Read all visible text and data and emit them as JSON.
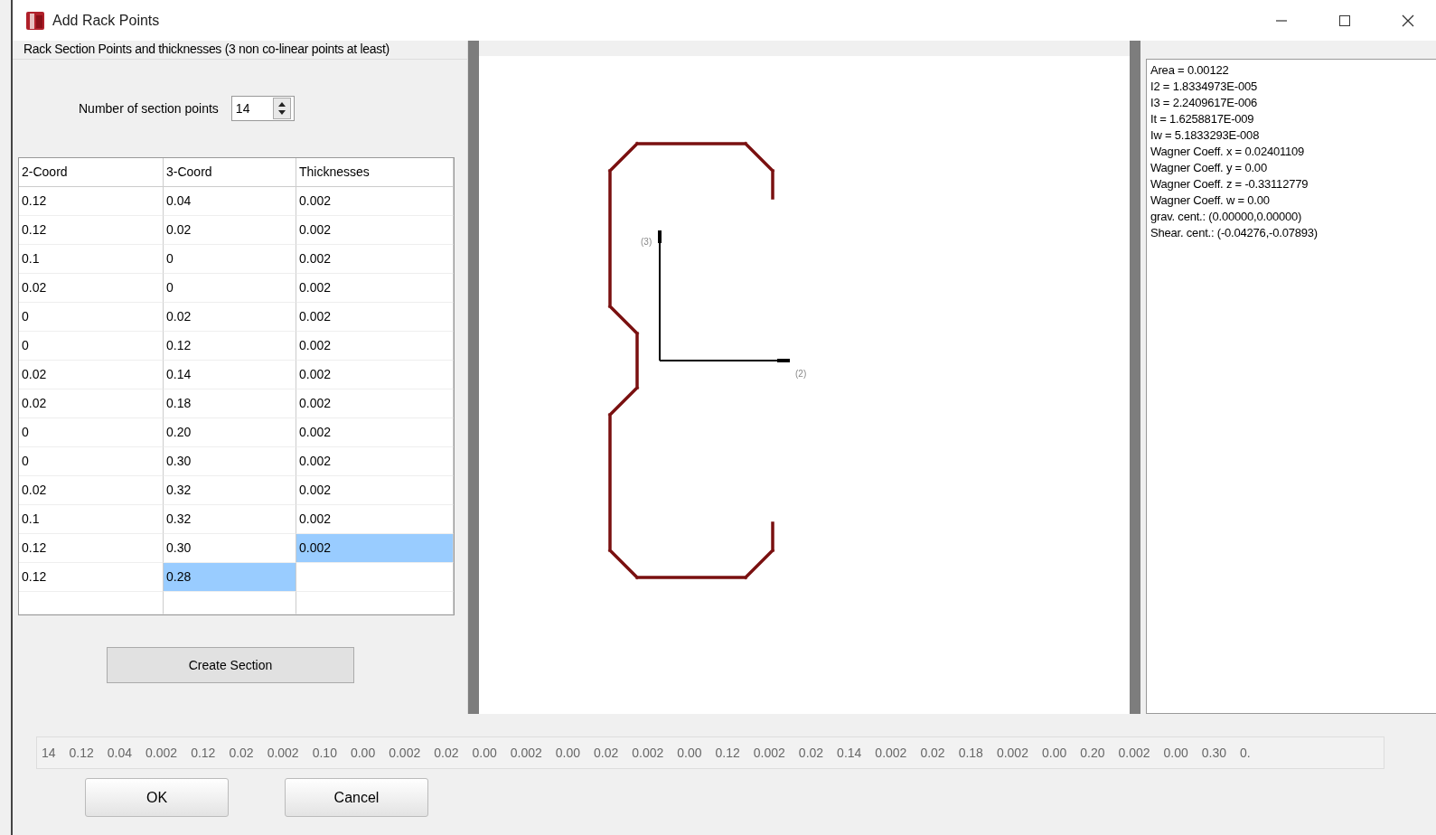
{
  "window": {
    "title": "Add Rack Points"
  },
  "group_title": "Rack Section Points and thicknesses (3 non co-linear points at least)",
  "section_points": {
    "label": "Number of section points",
    "value": "14"
  },
  "table": {
    "columns": [
      "2-Coord",
      "3-Coord",
      "Thicknesses"
    ],
    "rows": [
      {
        "cells": [
          {
            "text": "0.12",
            "selected": false
          },
          {
            "text": "0.04",
            "selected": false
          },
          {
            "text": "0.002",
            "selected": false
          }
        ]
      },
      {
        "cells": [
          {
            "text": "0.12",
            "selected": false
          },
          {
            "text": "0.02",
            "selected": false
          },
          {
            "text": "0.002",
            "selected": false
          }
        ]
      },
      {
        "cells": [
          {
            "text": "0.1",
            "selected": false
          },
          {
            "text": "0",
            "selected": false
          },
          {
            "text": "0.002",
            "selected": false
          }
        ]
      },
      {
        "cells": [
          {
            "text": "0.02",
            "selected": false
          },
          {
            "text": "0",
            "selected": false
          },
          {
            "text": "0.002",
            "selected": false
          }
        ]
      },
      {
        "cells": [
          {
            "text": "0",
            "selected": false
          },
          {
            "text": "0.02",
            "selected": false
          },
          {
            "text": "0.002",
            "selected": false
          }
        ]
      },
      {
        "cells": [
          {
            "text": "0",
            "selected": false
          },
          {
            "text": "0.12",
            "selected": false
          },
          {
            "text": "0.002",
            "selected": false
          }
        ]
      },
      {
        "cells": [
          {
            "text": "0.02",
            "selected": false
          },
          {
            "text": "0.14",
            "selected": false
          },
          {
            "text": "0.002",
            "selected": false
          }
        ]
      },
      {
        "cells": [
          {
            "text": "0.02",
            "selected": false
          },
          {
            "text": "0.18",
            "selected": false
          },
          {
            "text": "0.002",
            "selected": false
          }
        ]
      },
      {
        "cells": [
          {
            "text": "0",
            "selected": false
          },
          {
            "text": "0.20",
            "selected": false
          },
          {
            "text": "0.002",
            "selected": false
          }
        ]
      },
      {
        "cells": [
          {
            "text": "0",
            "selected": false
          },
          {
            "text": "0.30",
            "selected": false
          },
          {
            "text": "0.002",
            "selected": false
          }
        ]
      },
      {
        "cells": [
          {
            "text": "0.02",
            "selected": false
          },
          {
            "text": "0.32",
            "selected": false
          },
          {
            "text": "0.002",
            "selected": false
          }
        ]
      },
      {
        "cells": [
          {
            "text": "0.1",
            "selected": false
          },
          {
            "text": "0.32",
            "selected": false
          },
          {
            "text": "0.002",
            "selected": false
          }
        ]
      },
      {
        "cells": [
          {
            "text": "0.12",
            "selected": false
          },
          {
            "text": "0.30",
            "selected": false
          },
          {
            "text": "0.002",
            "selected": true
          }
        ]
      },
      {
        "cells": [
          {
            "text": "0.12",
            "selected": false
          },
          {
            "text": "0.28",
            "selected": true
          }
        ]
      }
    ]
  },
  "create_button": "Create Section",
  "axes": {
    "axis_3": "(3)",
    "axis_2": "(2)"
  },
  "properties": [
    "Area = 0.00122",
    "I2 = 1.8334973E-005",
    "I3 = 2.2409617E-006",
    "It = 1.6258817E-009",
    "Iw = 5.1833293E-008",
    "Wagner Coeff. x = 0.02401109",
    "Wagner Coeff. y = 0.00",
    "Wagner Coeff. z = -0.33112779",
    "Wagner Coeff. w = 0.00",
    "grav. cent.: (0.00000,0.00000)",
    "Shear. cent.: (-0.04276,-0.07893)"
  ],
  "data_string": [
    "14",
    "0.12",
    "0.04",
    "0.002",
    "0.12",
    "0.02",
    "0.002",
    "0.10",
    "0.00",
    "0.002",
    "0.02",
    "0.00",
    "0.002",
    "0.00",
    "0.02",
    "0.002",
    "0.00",
    "0.12",
    "0.002",
    "0.02",
    "0.14",
    "0.002",
    "0.02",
    "0.18",
    "0.002",
    "0.00",
    "0.20",
    "0.002",
    "0.00",
    "0.30",
    "0."
  ],
  "buttons": [
    "OK",
    "Cancel"
  ]
}
